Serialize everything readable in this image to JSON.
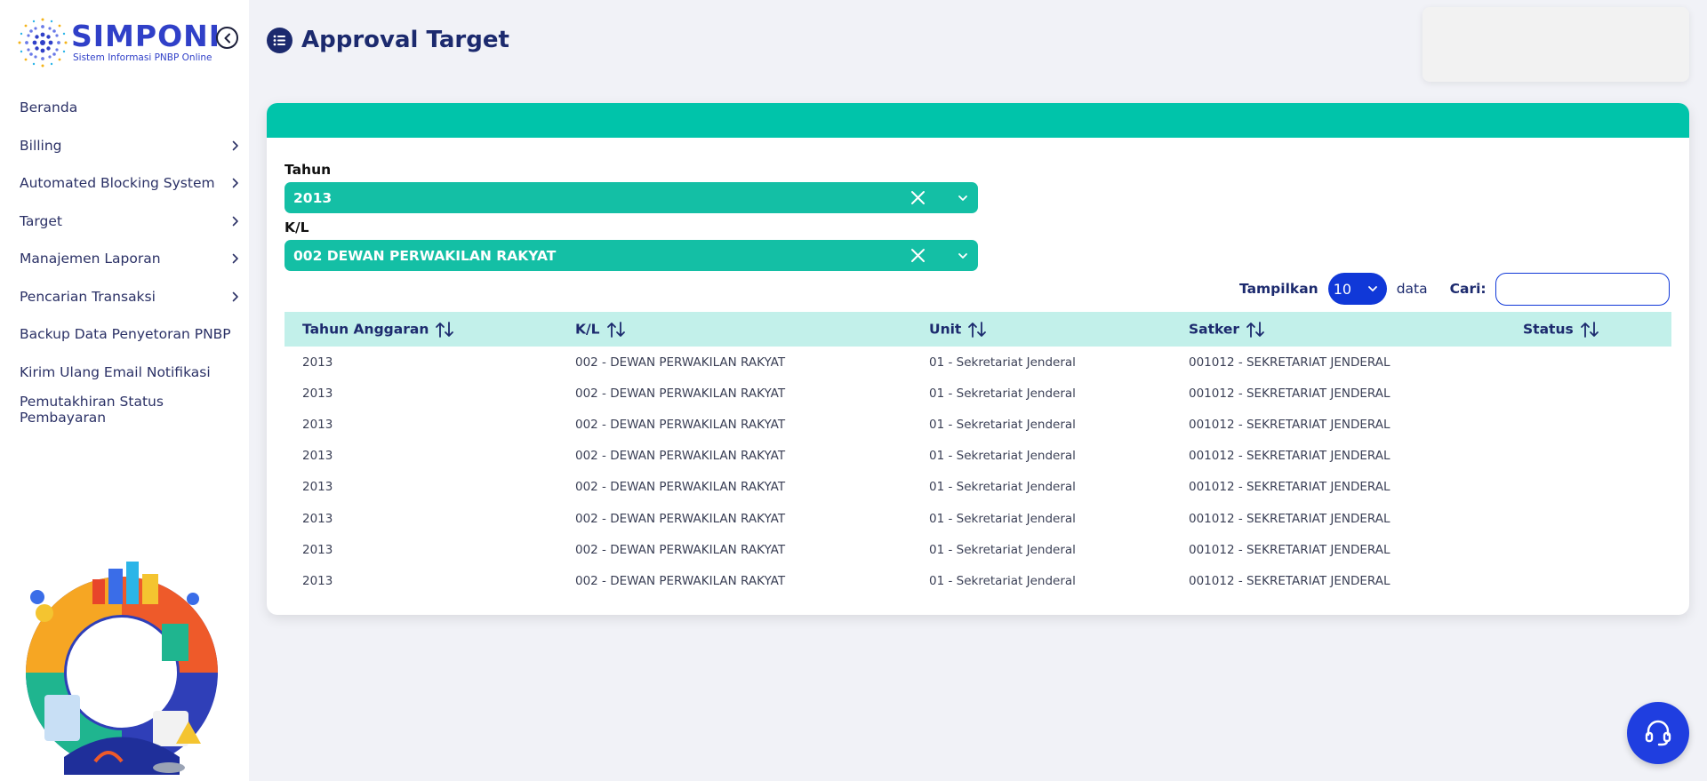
{
  "app": {
    "name": "SIMPONI",
    "tagline": "Sistem Informasi PNBP Online"
  },
  "sidebar": {
    "items": [
      {
        "label": "Beranda",
        "has_submenu": false
      },
      {
        "label": "Billing",
        "has_submenu": true
      },
      {
        "label": "Automated Blocking System",
        "has_submenu": true
      },
      {
        "label": "Target",
        "has_submenu": true
      },
      {
        "label": "Manajemen Laporan",
        "has_submenu": true
      },
      {
        "label": "Pencarian Transaksi",
        "has_submenu": true
      },
      {
        "label": "Backup Data Penyetoran PNBP",
        "has_submenu": false
      },
      {
        "label": "Kirim Ulang Email Notifikasi",
        "has_submenu": false
      },
      {
        "label": "Pemutakhiran Status Pembayaran",
        "has_submenu": false
      }
    ]
  },
  "header": {
    "title": "Approval Target"
  },
  "filters": {
    "tahun": {
      "label": "Tahun",
      "value": "2013"
    },
    "kl": {
      "label": "K/L",
      "value": "002 DEWAN PERWAKILAN RAKYAT"
    }
  },
  "table_controls": {
    "show_label": "Tampilkan",
    "page_size": "10",
    "data_label": "data",
    "search_label": "Cari:",
    "search_value": ""
  },
  "table": {
    "columns": [
      "Tahun Anggaran",
      "K/L",
      "Unit",
      "Satker",
      "Status"
    ],
    "rows": [
      [
        "2013",
        "002 - DEWAN PERWAKILAN RAKYAT",
        "01 - Sekretariat Jenderal",
        "001012 - SEKRETARIAT JENDERAL",
        ""
      ],
      [
        "2013",
        "002 - DEWAN PERWAKILAN RAKYAT",
        "01 - Sekretariat Jenderal",
        "001012 - SEKRETARIAT JENDERAL",
        ""
      ],
      [
        "2013",
        "002 - DEWAN PERWAKILAN RAKYAT",
        "01 - Sekretariat Jenderal",
        "001012 - SEKRETARIAT JENDERAL",
        ""
      ],
      [
        "2013",
        "002 - DEWAN PERWAKILAN RAKYAT",
        "01 - Sekretariat Jenderal",
        "001012 - SEKRETARIAT JENDERAL",
        ""
      ],
      [
        "2013",
        "002 - DEWAN PERWAKILAN RAKYAT",
        "01 - Sekretariat Jenderal",
        "001012 - SEKRETARIAT JENDERAL",
        ""
      ],
      [
        "2013",
        "002 - DEWAN PERWAKILAN RAKYAT",
        "01 - Sekretariat Jenderal",
        "001012 - SEKRETARIAT JENDERAL",
        ""
      ],
      [
        "2013",
        "002 - DEWAN PERWAKILAN RAKYAT",
        "01 - Sekretariat Jenderal",
        "001012 - SEKRETARIAT JENDERAL",
        ""
      ],
      [
        "2013",
        "002 - DEWAN PERWAKILAN RAKYAT",
        "01 - Sekretariat Jenderal",
        "001012 - SEKRETARIAT JENDERAL",
        ""
      ]
    ]
  },
  "colors": {
    "brand": "#3040c8",
    "accent_teal": "#00c4aa",
    "header_navy": "#1c2a6e",
    "table_header_bg": "#c2f0ea",
    "button_blue": "#1038d8"
  },
  "icons": {
    "collapse": "chevron-left-circle-icon",
    "header": "list-icon",
    "help": "headset-icon"
  }
}
